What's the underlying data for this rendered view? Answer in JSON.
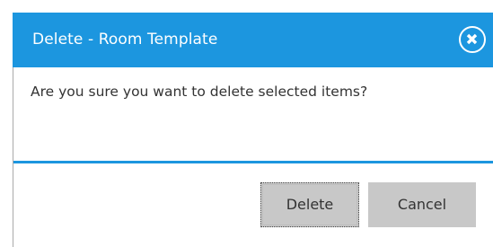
{
  "dialog": {
    "title": "Delete - Room Template",
    "close_icon": "close-circle-x-icon",
    "message": "Are you sure you want to delete selected items?",
    "buttons": {
      "delete_label": "Delete",
      "cancel_label": "Cancel"
    }
  },
  "colors": {
    "accent": "#1c96df",
    "button_bg": "#c8c8c8",
    "text": "#333333"
  }
}
